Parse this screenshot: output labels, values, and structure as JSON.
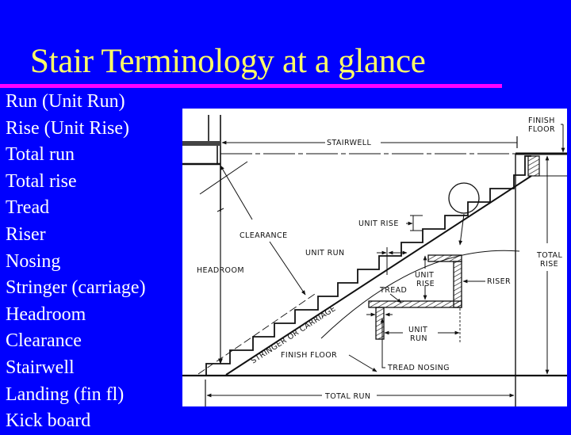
{
  "slide": {
    "title": "Stair Terminology at a glance",
    "background_color": "#0000fe",
    "title_color": "#ffff66",
    "rule_color": "#ff00ff"
  },
  "terms": [
    "Run (Unit Run)",
    "Rise (Unit Rise)",
    "Total run",
    "Total rise",
    "Tread",
    "Riser",
    "Nosing",
    "Stringer (carriage)",
    "Headroom",
    "Clearance",
    "Stairwell",
    "Landing (fin fl)",
    "Kick board"
  ],
  "diagram": {
    "labels": {
      "stairwell": "STAIRWELL",
      "finish_floor_top_1": "FINISH",
      "finish_floor_top_2": "FLOOR",
      "clearance": "CLEARANCE",
      "unit_rise": "UNIT RISE",
      "unit_run": "UNIT RUN",
      "headroom": "HEADROOM",
      "total_rise_1": "TOTAL",
      "total_rise_2": "RISE",
      "detail_unit_rise_1": "UNIT",
      "detail_unit_rise_2": "RISE",
      "tread": "TREAD",
      "riser": "RISER",
      "stringer": "STRINGER OR CARRIAGE",
      "detail_unit_run_1": "UNIT",
      "detail_unit_run_2": "RUN",
      "finish_floor_bottom": "FINISH FLOOR",
      "tread_nosing": "TREAD NOSING",
      "total_run": "TOTAL RUN"
    }
  }
}
